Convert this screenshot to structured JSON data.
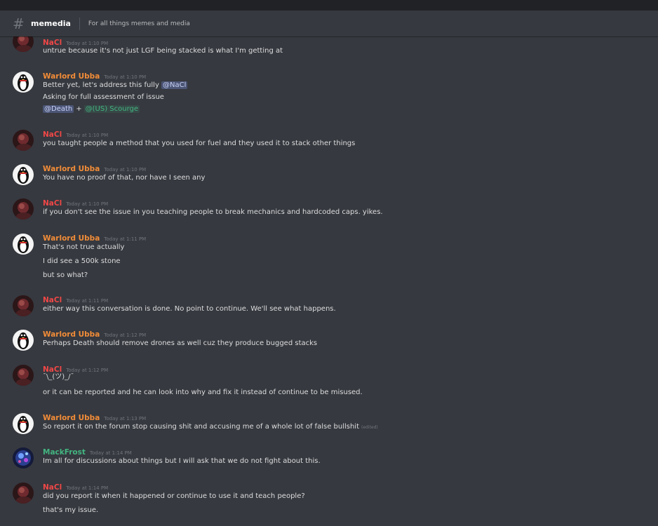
{
  "channel": {
    "name": "memedia",
    "topic": "For all things memes and media"
  },
  "colors": {
    "nacl": "#f04747",
    "ubba": "#f28c38",
    "mackfrost": "#43b581",
    "mention": "#7289da",
    "role_scourge": "#43b581"
  },
  "messages": [
    {
      "author": "NaCl",
      "time": "Today at 1:10 PM",
      "lines": [
        "untrue because it's not just LGF being stacked is what I'm getting at"
      ]
    },
    {
      "author": "Warlord Ubba",
      "time": "Today at 1:10 PM",
      "lines": [
        "Better yet, let's address this fully",
        "Asking for full assessment of issue"
      ],
      "mention_nacl": "@NaCl",
      "mention_death": "@Death",
      "plus": "+",
      "mention_scourge": "@(US) Scourge"
    },
    {
      "author": "NaCl",
      "time": "Today at 1:10 PM",
      "lines": [
        "you taught people a method that you used for fuel and they used it to stack other things"
      ]
    },
    {
      "author": "Warlord Ubba",
      "time": "Today at 1:10 PM",
      "lines": [
        "You have no proof of that, nor have I seen any"
      ]
    },
    {
      "author": "NaCl",
      "time": "Today at 1:10 PM",
      "lines": [
        "if you don't see the issue in you teaching people to break mechanics and hardcoded caps. yikes."
      ]
    },
    {
      "author": "Warlord Ubba",
      "time": "Today at 1:11 PM",
      "lines": [
        "That's not true actually",
        "I did see a 500k stone",
        "but so what?"
      ]
    },
    {
      "author": "NaCl",
      "time": "Today at 1:11 PM",
      "lines": [
        "either way this conversation is done. No point to continue. We'll see what happens."
      ]
    },
    {
      "author": "Warlord Ubba",
      "time": "Today at 1:12 PM",
      "lines": [
        "Perhaps Death should remove drones as well cuz they produce bugged stacks"
      ]
    },
    {
      "author": "NaCl",
      "time": "Today at 1:12 PM",
      "lines": [
        "¯\\_(ツ)_/¯",
        "or it can be reported and he can look into why and fix it instead of continue to be misused."
      ]
    },
    {
      "author": "Warlord Ubba",
      "time": "Today at 1:13 PM",
      "lines": [
        "So report it on the forum stop causing shit and accusing me of a whole lot of false bullshit"
      ],
      "edited": "(edited)"
    },
    {
      "author": "MackFrost",
      "time": "Today at 1:14 PM",
      "lines": [
        "Im all for discussions about things but I will ask that we do not fight  about this."
      ]
    },
    {
      "author": "NaCl",
      "time": "Today at 1:14 PM",
      "lines": [
        "did you report it when it happened or continue to use it and teach people?",
        "that's my issue."
      ]
    }
  ]
}
